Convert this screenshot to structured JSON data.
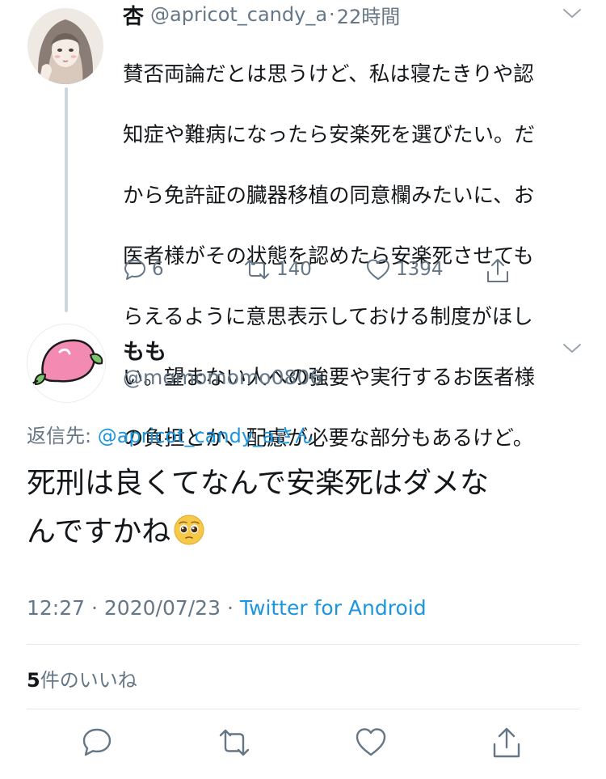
{
  "parent_tweet": {
    "display_name": "杏",
    "handle": "@apricot_candy_a",
    "separator": "·",
    "time": "22時間",
    "text_lines": [
      "賛否両論だとは思うけど、私は寝たきりや認",
      "知症や難病になったら安楽死を選びたい。だ",
      "から免許証の臓器移植の同意欄みたいに、お",
      "医者様がその状態を認めたら安楽死させても",
      "らえるように意思表示しておける制度がほし",
      "い。望まない人への強要や実行するお医者様",
      "の負担とか、配慮が必要な部分もあるけど。"
    ],
    "reply_count": "6",
    "retweet_count": "140",
    "like_count": "1394"
  },
  "main_tweet": {
    "display_name": "もも",
    "handle": "@momomomo0806",
    "reply_to_label": "返信先: ",
    "reply_to_handle": "@apricot_candy_a",
    "reply_to_suffix": "さん",
    "text_line1": "死刑は良くてなんで安楽死はダメな",
    "text_line2": "んですかね",
    "time": "12:27",
    "meta_separator": "·",
    "date": "2020/07/23",
    "source": "Twitter for Android",
    "likes_number": "5",
    "likes_label": "件のいいね"
  },
  "icons": {
    "reply": "reply-icon",
    "retweet": "retweet-icon",
    "like": "heart-icon",
    "share": "share-icon",
    "menu": "chevron-down-icon",
    "emoji": "pleading-face-emoji"
  },
  "colors": {
    "text": "#14171a",
    "secondary": "#657786",
    "link": "#1b95e0",
    "divider": "#e1e8ed",
    "thread_line": "#ccd6dd",
    "peach_pink": "#f28ab2",
    "leaf_green": "#7cc46a"
  }
}
